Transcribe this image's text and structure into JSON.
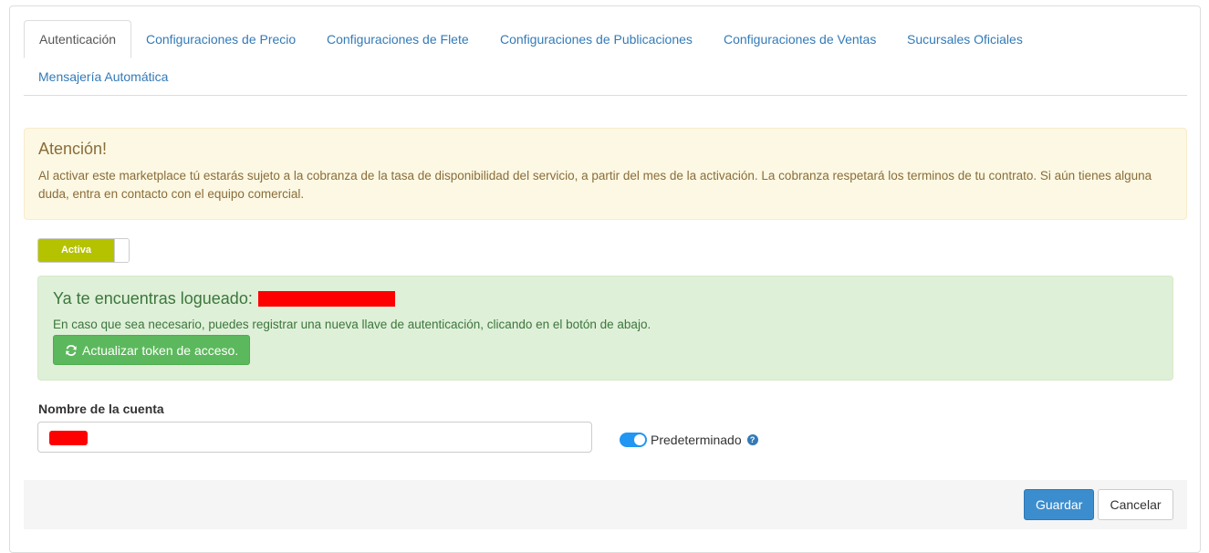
{
  "tabs": [
    {
      "label": "Autenticación",
      "active": true
    },
    {
      "label": "Configuraciones de Precio"
    },
    {
      "label": "Configuraciones de Flete"
    },
    {
      "label": "Configuraciones de Publicaciones"
    },
    {
      "label": "Configuraciones de Ventas"
    },
    {
      "label": "Sucursales Oficiales"
    },
    {
      "label": "Mensajería Automática"
    }
  ],
  "warning": {
    "title": "Atención!",
    "text": "Al activar este marketplace tú estarás sujeto a la cobranza de la tasa de disponibilidad del servicio, a partir del mes de la activación. La cobranza respetará los terminos de tu contrato. Si aún tienes alguna duda, entra en contacto con el equipo comercial."
  },
  "status_toggle": {
    "label": "Activa",
    "on": true
  },
  "login": {
    "title": "Ya te encuentras logueado:",
    "text": "En caso que sea necesario, puedes registrar una nueva llave de autenticación, clicando en el botón de abajo.",
    "refresh_button": "Actualizar token de acceso."
  },
  "account": {
    "label": "Nombre de la cuenta",
    "value": ""
  },
  "default_switch": {
    "label": "Predeterminado",
    "on": true,
    "help": "?"
  },
  "footer": {
    "save": "Guardar",
    "cancel": "Cancelar"
  },
  "colors": {
    "link": "#337ab7",
    "toggle_on": "#b5c200",
    "success_btn": "#5cb85c",
    "primary_btn": "#3c8dcd",
    "switch_on": "#2196f3"
  }
}
